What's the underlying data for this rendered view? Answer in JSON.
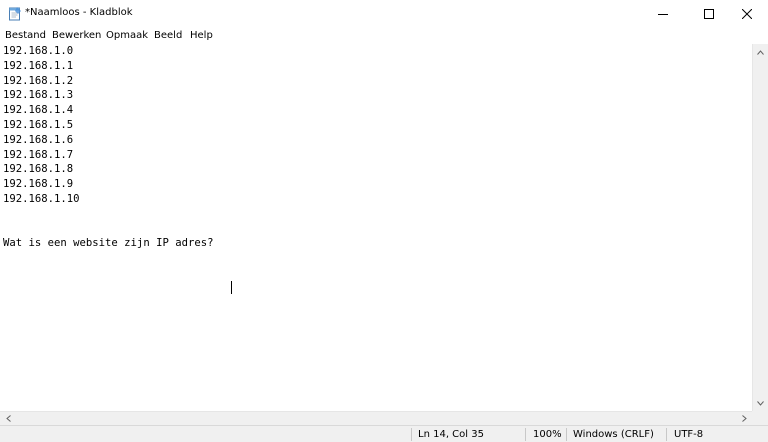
{
  "window": {
    "title": "*Naamloos - Kladblok",
    "icons": {
      "app": "notepad-icon",
      "minimize": "minimize-icon",
      "maximize": "maximize-icon",
      "close": "close-icon"
    }
  },
  "menu": {
    "items": [
      {
        "label": "Bestand"
      },
      {
        "label": "Bewerken"
      },
      {
        "label": "Opmaak"
      },
      {
        "label": "Beeld"
      },
      {
        "label": "Help"
      }
    ]
  },
  "editor": {
    "content": "192.168.1.0\n192.168.1.1\n192.168.1.2\n192.168.1.3\n192.168.1.4\n192.168.1.5\n192.168.1.6\n192.168.1.7\n192.168.1.8\n192.168.1.9\n192.168.1.10\n\n\nWat is een website zijn IP adres?"
  },
  "statusbar": {
    "position": "Ln 14, Col 35",
    "zoom": "100%",
    "line_ending": "Windows (CRLF)",
    "encoding": "UTF-8"
  },
  "colors": {
    "chrome": "#f0f0f0",
    "text": "#000000",
    "background": "#ffffff"
  }
}
